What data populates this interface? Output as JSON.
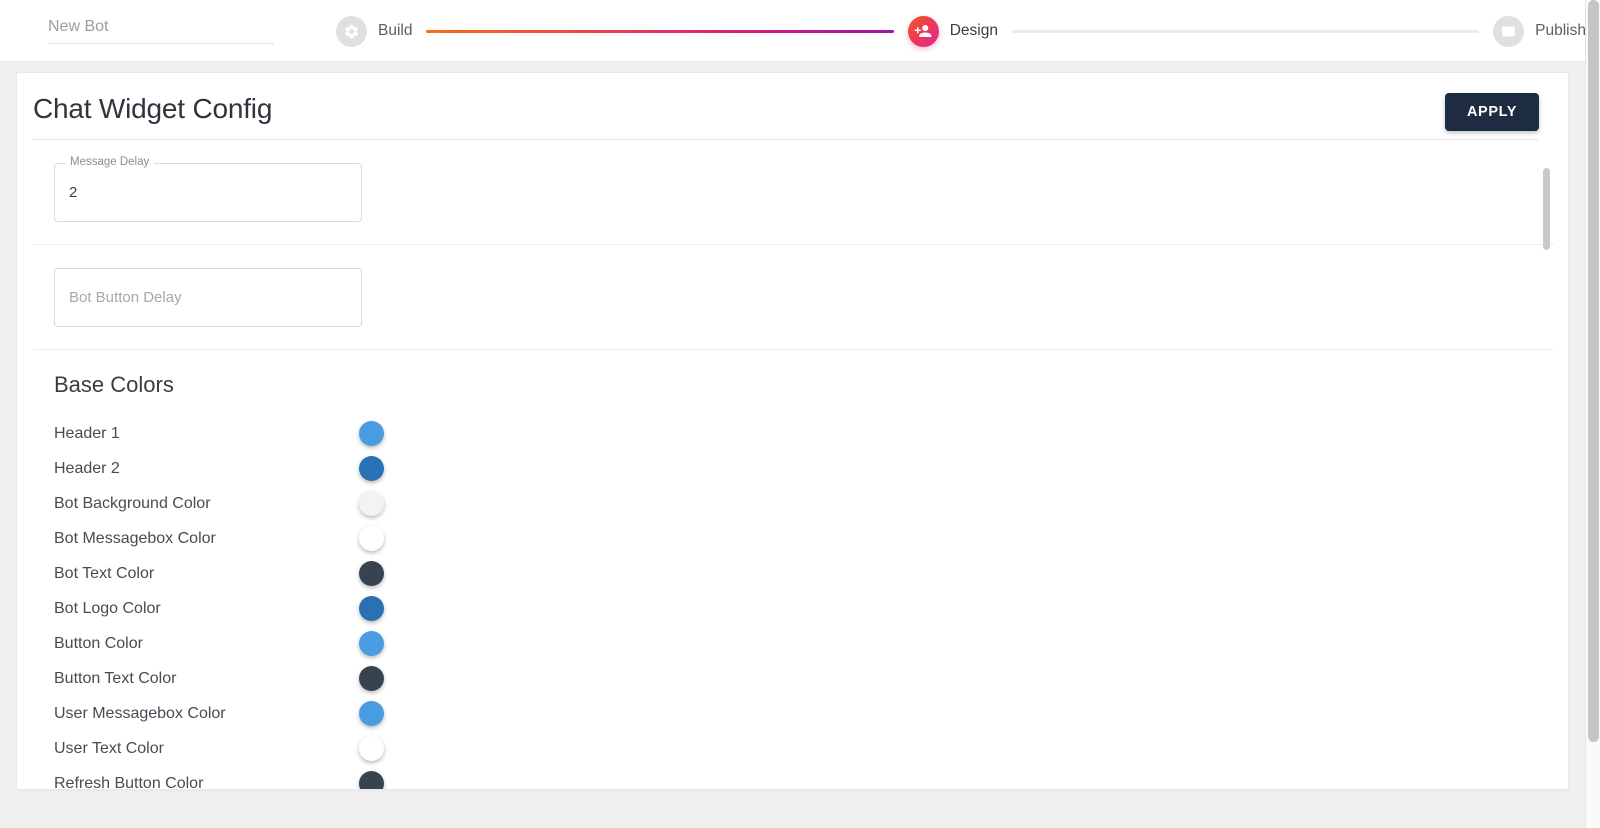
{
  "topbar": {
    "bot_name_value": "",
    "bot_name_placeholder": "New Bot"
  },
  "stepper": {
    "steps": [
      {
        "label": "Build",
        "icon": "gear-icon",
        "state": "inactive"
      },
      {
        "label": "Design",
        "icon": "group-add-icon",
        "state": "active"
      },
      {
        "label": "Publish",
        "icon": "window-icon",
        "state": "inactive"
      }
    ],
    "connector_filled_gradient": "#ee7318,#e8424f,#d9256f,#9c12b0",
    "connector_empty_color": "#eceaee"
  },
  "card": {
    "title": "Chat Widget Config",
    "apply_label": "APPLY"
  },
  "fields": [
    {
      "name": "message-delay",
      "label": "Message Delay",
      "value": "2",
      "placeholder": "",
      "has_floating_label": true
    },
    {
      "name": "bot-button-delay",
      "label": "",
      "value": "",
      "placeholder": "Bot Button Delay",
      "has_floating_label": false
    }
  ],
  "base_colors": {
    "title": "Base Colors",
    "items": [
      {
        "label": "Header 1",
        "color": "#4a9ce0"
      },
      {
        "label": "Header 2",
        "color": "#2a70b4"
      },
      {
        "label": "Bot Background Color",
        "color": "#f2f3f5"
      },
      {
        "label": "Bot Messagebox Color",
        "color": "#ffffff"
      },
      {
        "label": "Bot Text Color",
        "color": "#37444f"
      },
      {
        "label": "Bot Logo Color",
        "color": "#2a70b4"
      },
      {
        "label": "Button Color",
        "color": "#4a9ce0"
      },
      {
        "label": "Button Text Color",
        "color": "#37444f"
      },
      {
        "label": "User Messagebox Color",
        "color": "#4a9ce0"
      },
      {
        "label": "User Text Color",
        "color": "#ffffff"
      },
      {
        "label": "Refresh Button Color",
        "color": "#37444f"
      }
    ]
  },
  "theme": {
    "apply_button_bg": "#1d2c41",
    "page_bg": "#f0f0f0",
    "card_bg": "#ffffff"
  }
}
